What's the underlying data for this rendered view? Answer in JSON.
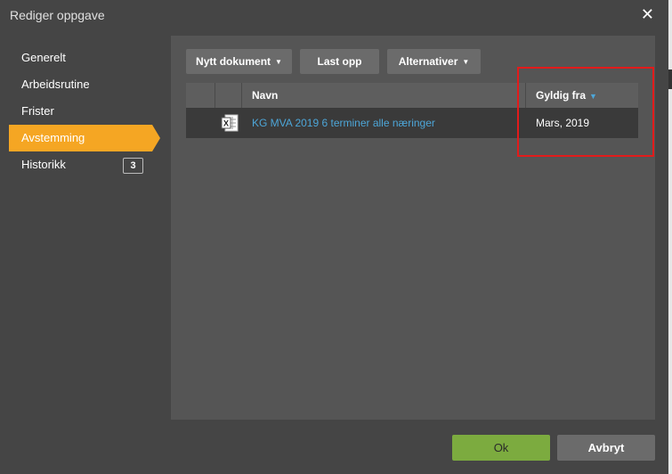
{
  "dialog": {
    "title": "Rediger oppgave",
    "close_glyph": "✕"
  },
  "sidebar": {
    "items": [
      {
        "label": "Generelt"
      },
      {
        "label": "Arbeidsrutine"
      },
      {
        "label": "Frister"
      },
      {
        "label": "Avstemming",
        "active": true
      },
      {
        "label": "Historikk",
        "badge": "3"
      }
    ]
  },
  "toolbar": {
    "new_document": "Nytt dokument",
    "upload": "Last opp",
    "alternatives": "Alternativer",
    "caret": "▼"
  },
  "grid": {
    "columns": [
      "",
      "",
      "Navn",
      "Gyldig fra"
    ],
    "sort_indicator": "▼",
    "rows": [
      {
        "icon": "excel-icon",
        "name": "KG MVA 2019 6 terminer alle næringer",
        "valid_from": "Mars, 2019"
      }
    ]
  },
  "footer": {
    "ok": "Ok",
    "cancel": "Avbryt"
  },
  "colors": {
    "accent": "#f5a623",
    "ok": "#7cab3f",
    "link": "#4da6d8",
    "highlight": "#e21b1b"
  }
}
